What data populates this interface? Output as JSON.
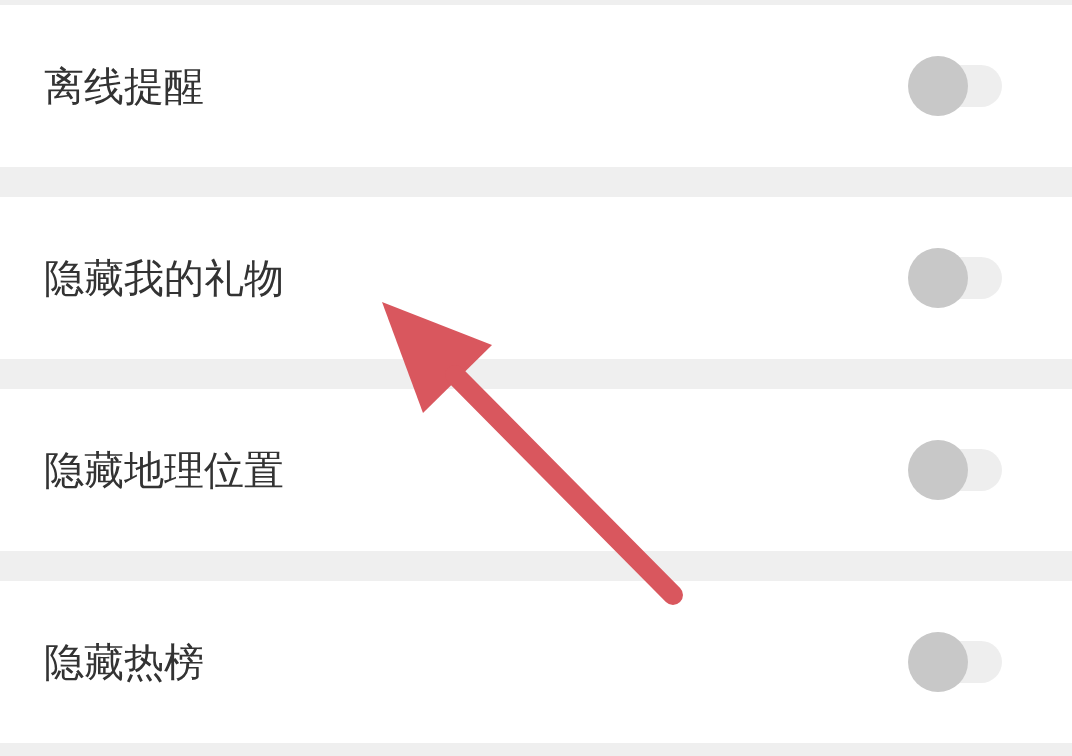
{
  "settings": [
    {
      "label": "离线提醒",
      "on": false
    },
    {
      "label": "隐藏我的礼物",
      "on": false
    },
    {
      "label": "隐藏地理位置",
      "on": false
    },
    {
      "label": "隐藏热榜",
      "on": false
    }
  ]
}
